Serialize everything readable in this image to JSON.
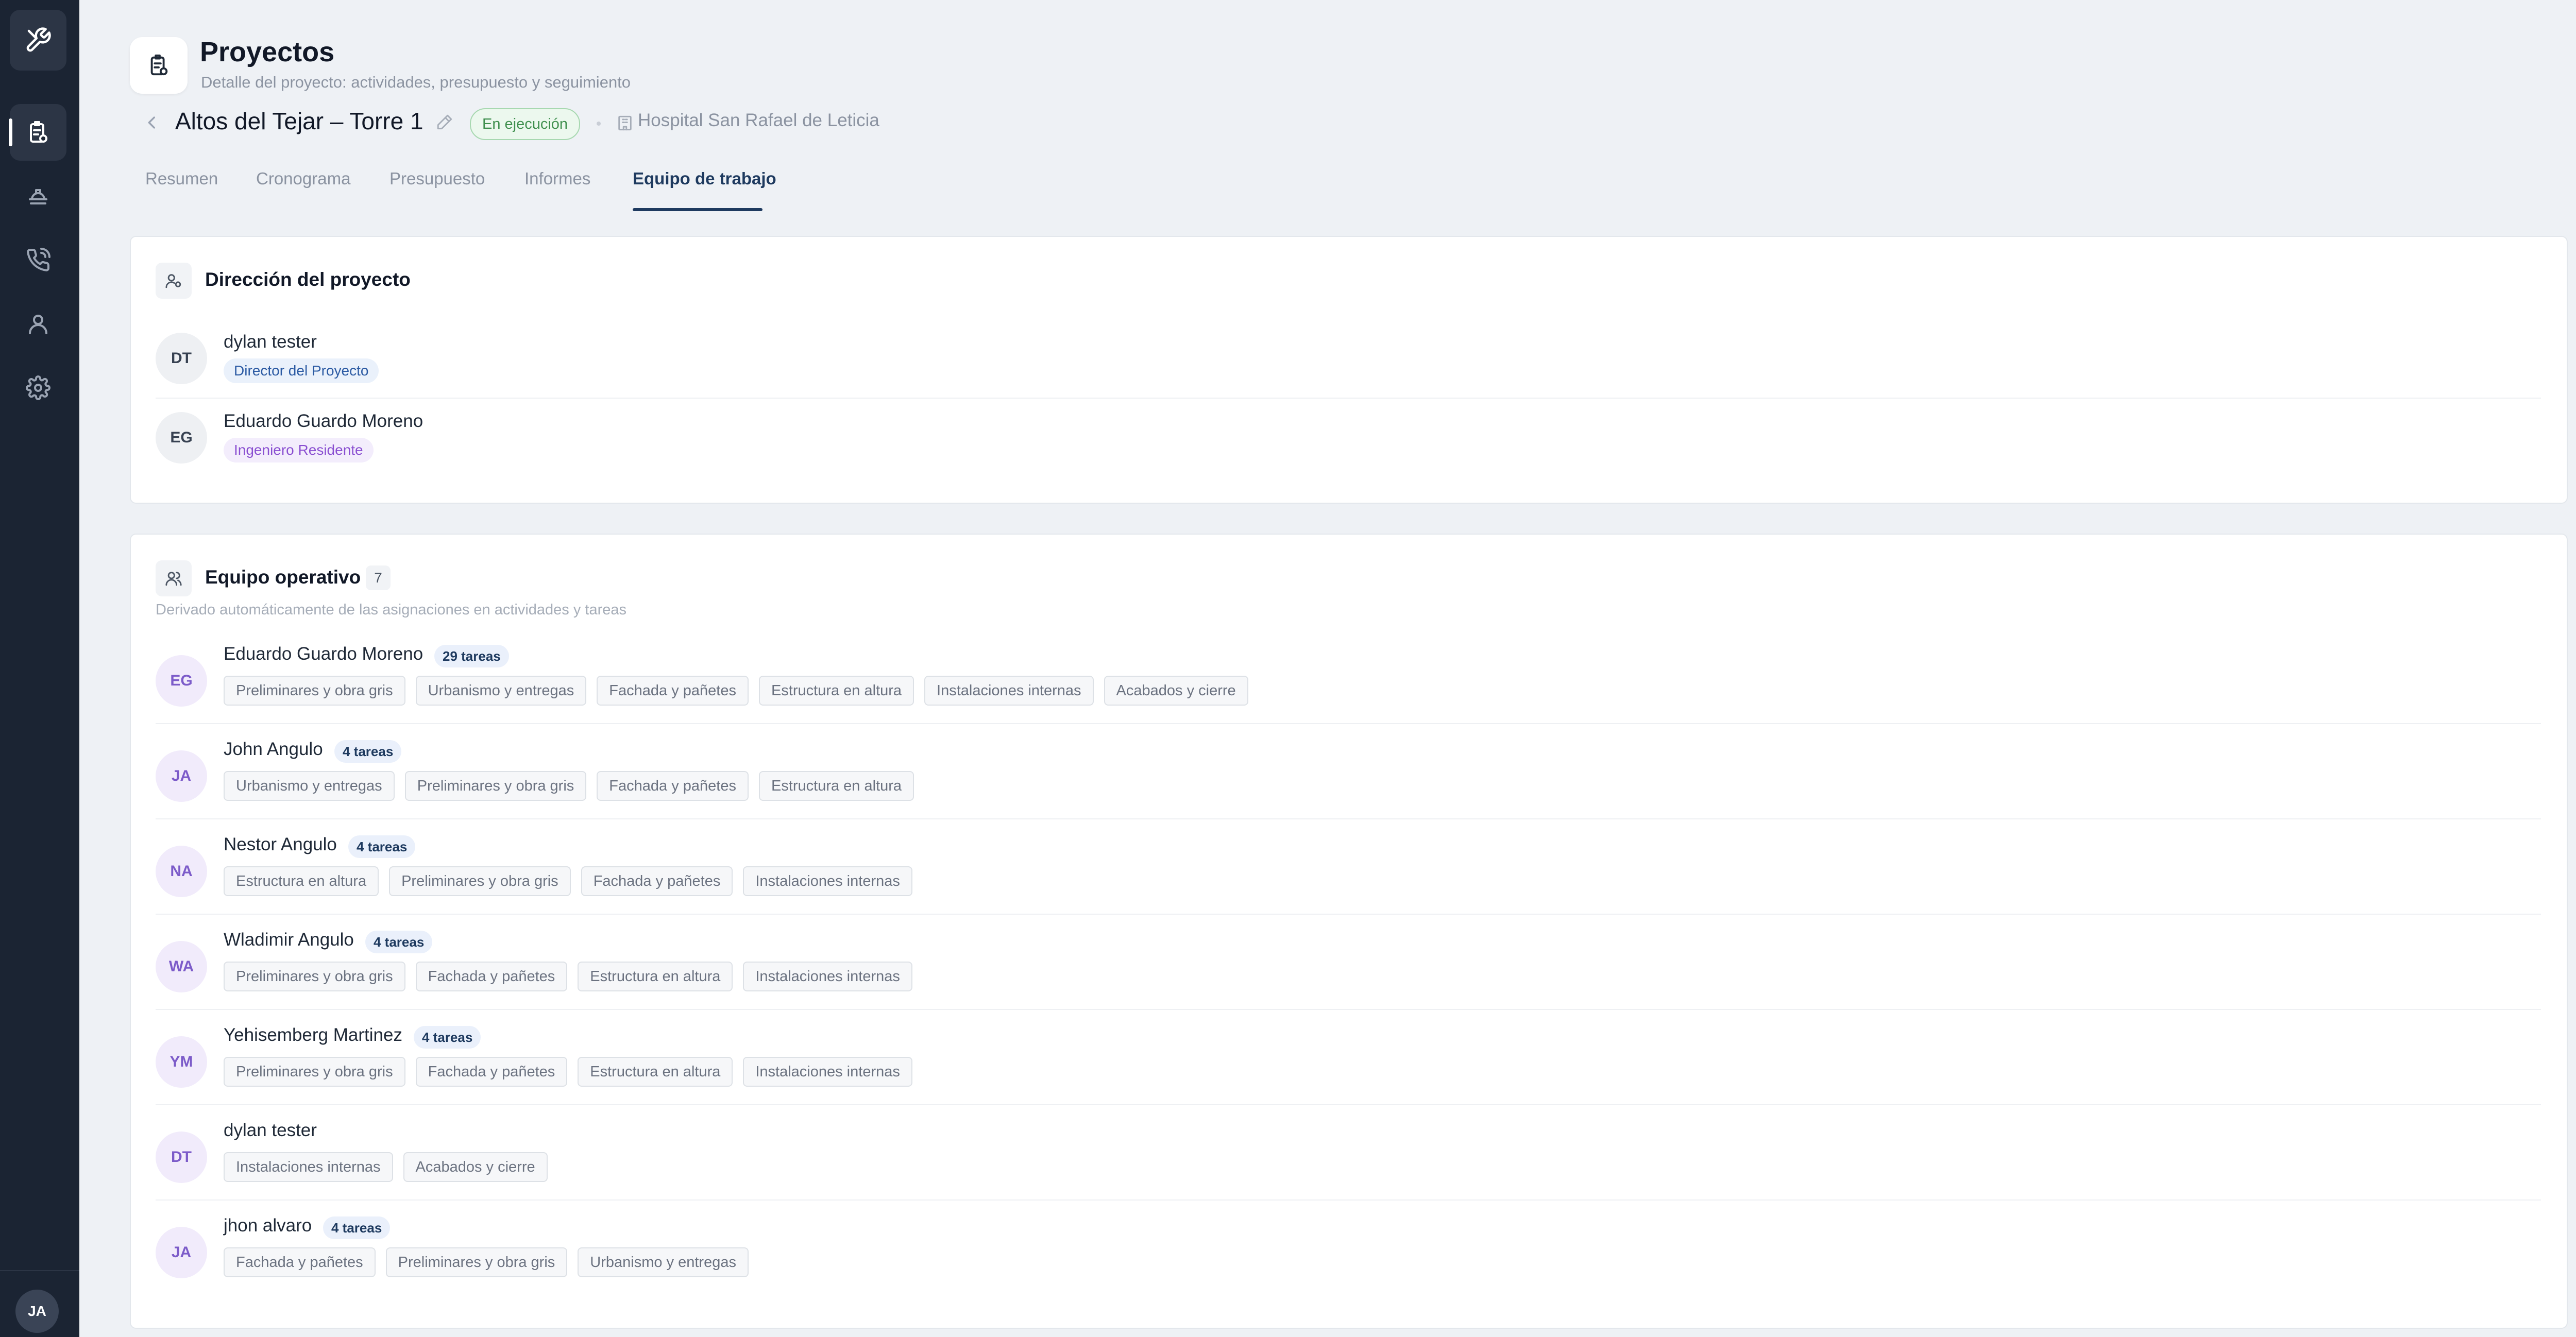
{
  "sidebar": {
    "items": [
      {
        "name": "projects-icon",
        "active": true
      },
      {
        "name": "helmet-icon",
        "active": false
      },
      {
        "name": "phone-icon",
        "active": false
      },
      {
        "name": "user-icon",
        "active": false
      },
      {
        "name": "gear-icon",
        "active": false
      }
    ],
    "user_initials": "JA"
  },
  "header": {
    "title": "Proyectos",
    "subtitle": "Detalle del proyecto: actividades, presupuesto y seguimiento"
  },
  "project": {
    "name": "Altos del Tejar – Torre 1",
    "status": "En ejecución",
    "client": "Hospital San Rafael de Leticia"
  },
  "tabs": [
    {
      "label": "Resumen"
    },
    {
      "label": "Cronograma"
    },
    {
      "label": "Presupuesto"
    },
    {
      "label": "Informes"
    },
    {
      "label": "Equipo de trabajo",
      "active": true
    }
  ],
  "direction": {
    "title": "Dirección del proyecto",
    "members": [
      {
        "initials": "DT",
        "name": "dylan tester",
        "role": "Director del Proyecto"
      },
      {
        "initials": "EG",
        "name": "Eduardo Guardo Moreno",
        "role": "Ingeniero Residente"
      }
    ]
  },
  "operative": {
    "title": "Equipo operativo",
    "count": "7",
    "subtitle": "Derivado automáticamente de las asignaciones en actividades y tareas",
    "members": [
      {
        "initials": "EG",
        "name": "Eduardo Guardo Moreno",
        "tasks": "29 tareas",
        "chips": [
          "Preliminares y obra gris",
          "Urbanismo y entregas",
          "Fachada y pañetes",
          "Estructura en altura",
          "Instalaciones internas",
          "Acabados y cierre"
        ]
      },
      {
        "initials": "JA",
        "name": "John  Angulo",
        "tasks": "4 tareas",
        "chips": [
          "Urbanismo y entregas",
          "Preliminares y obra gris",
          "Fachada y pañetes",
          "Estructura en altura"
        ]
      },
      {
        "initials": "NA",
        "name": "Nestor  Angulo",
        "tasks": "4 tareas",
        "chips": [
          "Estructura en altura",
          "Preliminares y obra gris",
          "Fachada y pañetes",
          "Instalaciones internas"
        ]
      },
      {
        "initials": "WA",
        "name": "Wladimir Angulo",
        "tasks": "4 tareas",
        "chips": [
          "Preliminares y obra gris",
          "Fachada y pañetes",
          "Estructura en altura",
          "Instalaciones internas"
        ]
      },
      {
        "initials": "YM",
        "name": "Yehisemberg Martinez",
        "tasks": "4 tareas",
        "chips": [
          "Preliminares y obra gris",
          "Fachada y pañetes",
          "Estructura en altura",
          "Instalaciones internas"
        ]
      },
      {
        "initials": "DT",
        "name": "dylan tester",
        "tasks": "",
        "chips": [
          "Instalaciones internas",
          "Acabados y cierre"
        ]
      },
      {
        "initials": "JA",
        "name": "jhon alvaro",
        "tasks": "4 tareas",
        "chips": [
          "Fachada y pañetes",
          "Preliminares y obra gris",
          "Urbanismo y entregas"
        ]
      }
    ]
  }
}
